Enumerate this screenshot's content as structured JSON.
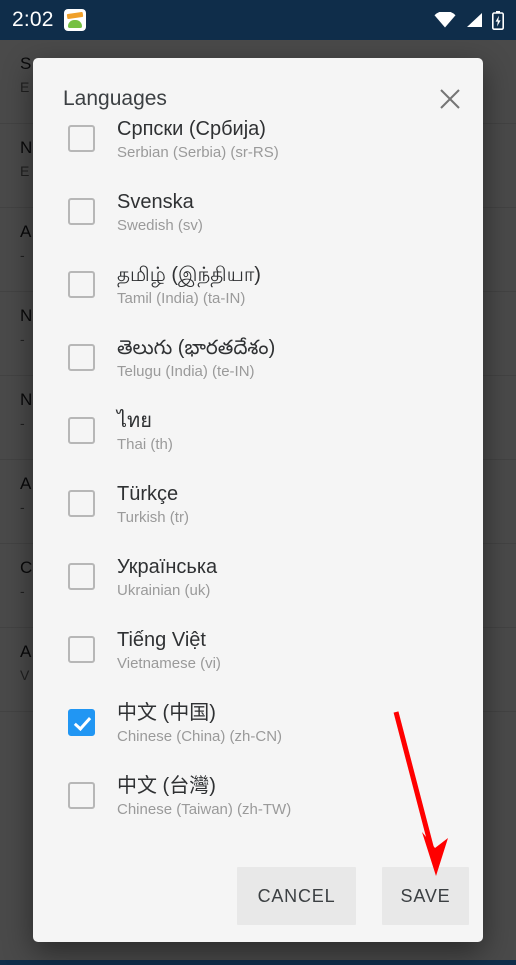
{
  "status_bar": {
    "time": "2:02",
    "notification_icon": "android-app-icon",
    "icons": [
      "wifi-icon",
      "cellular-signal-icon",
      "battery-charging-icon"
    ],
    "background_color": "#0f2d4a"
  },
  "background_app": {
    "rows": [
      {
        "title": "S",
        "subtitle": "E"
      },
      {
        "title": "N",
        "subtitle": "E"
      },
      {
        "title": "A",
        "subtitle": "-"
      },
      {
        "title": "N",
        "subtitle": "-"
      },
      {
        "title": "N",
        "subtitle": "-"
      },
      {
        "title": "A",
        "subtitle": "-"
      },
      {
        "title": "C",
        "subtitle": "-"
      },
      {
        "title": "A",
        "subtitle": "V"
      }
    ]
  },
  "dialog": {
    "title": "Languages",
    "close_icon": "close-icon",
    "accent_color": "#2196f3",
    "languages": [
      {
        "native": "Српски (Србија)",
        "english": "Serbian (Serbia) (sr-RS)",
        "checked": false
      },
      {
        "native": "Svenska",
        "english": "Swedish (sv)",
        "checked": false
      },
      {
        "native": "தமிழ் (இந்தியா)",
        "english": "Tamil (India) (ta-IN)",
        "checked": false
      },
      {
        "native": "తెలుగు (భారతదేశం)",
        "english": "Telugu (India) (te-IN)",
        "checked": false
      },
      {
        "native": "ไทย",
        "english": "Thai (th)",
        "checked": false
      },
      {
        "native": "Türkçe",
        "english": "Turkish (tr)",
        "checked": false
      },
      {
        "native": "Українська",
        "english": "Ukrainian (uk)",
        "checked": false
      },
      {
        "native": "Tiếng Việt",
        "english": "Vietnamese (vi)",
        "checked": false
      },
      {
        "native": "中文 (中国)",
        "english": "Chinese (China) (zh-CN)",
        "checked": true
      },
      {
        "native": "中文 (台灣)",
        "english": "Chinese (Taiwan) (zh-TW)",
        "checked": false
      }
    ],
    "buttons": {
      "cancel": "CANCEL",
      "save": "SAVE"
    }
  },
  "annotation": {
    "arrow_color": "#ff0000",
    "points_to": "save-button"
  }
}
